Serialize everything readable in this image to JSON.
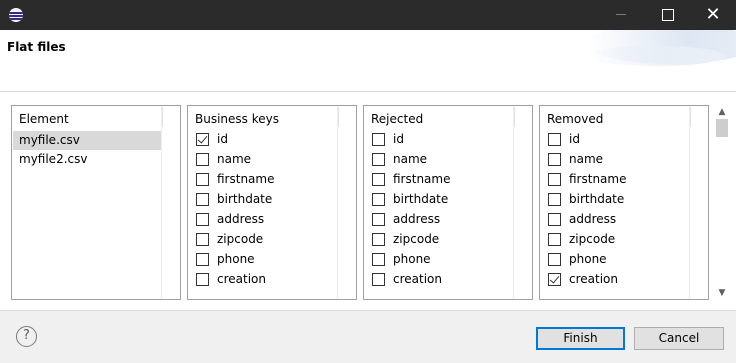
{
  "window": {
    "title": "",
    "close_glyph": "✕"
  },
  "header": {
    "title": "Flat files"
  },
  "element_panel": {
    "header": "Element",
    "items": [
      {
        "label": "myfile.csv",
        "selected": true
      },
      {
        "label": "myfile2.csv",
        "selected": false
      }
    ]
  },
  "business_keys": {
    "header": "Business keys",
    "items": [
      {
        "label": "id",
        "checked": true
      },
      {
        "label": "name",
        "checked": false
      },
      {
        "label": "firstname",
        "checked": false
      },
      {
        "label": "birthdate",
        "checked": false
      },
      {
        "label": "address",
        "checked": false
      },
      {
        "label": "zipcode",
        "checked": false
      },
      {
        "label": "phone",
        "checked": false
      },
      {
        "label": "creation",
        "checked": false
      }
    ]
  },
  "rejected": {
    "header": "Rejected",
    "items": [
      {
        "label": "id",
        "checked": false
      },
      {
        "label": "name",
        "checked": false
      },
      {
        "label": "firstname",
        "checked": false
      },
      {
        "label": "birthdate",
        "checked": false
      },
      {
        "label": "address",
        "checked": false
      },
      {
        "label": "zipcode",
        "checked": false
      },
      {
        "label": "phone",
        "checked": false
      },
      {
        "label": "creation",
        "checked": false
      }
    ]
  },
  "removed": {
    "header": "Removed",
    "items": [
      {
        "label": "id",
        "checked": false
      },
      {
        "label": "name",
        "checked": false
      },
      {
        "label": "firstname",
        "checked": false
      },
      {
        "label": "birthdate",
        "checked": false
      },
      {
        "label": "address",
        "checked": false
      },
      {
        "label": "zipcode",
        "checked": false
      },
      {
        "label": "phone",
        "checked": false
      },
      {
        "label": "creation",
        "checked": true
      }
    ]
  },
  "scrollbar": {
    "up_glyph": "▲",
    "down_glyph": "▼"
  },
  "footer": {
    "help_glyph": "?",
    "finish_label": "Finish",
    "cancel_label": "Cancel"
  },
  "icons": {
    "app": "eclipse-app-icon",
    "minimize": "minimize-icon",
    "maximize": "maximize-icon",
    "close": "close-icon",
    "help": "help-icon"
  },
  "colors": {
    "titlebar": "#2b2b2b",
    "default_button_border": "#0078d7",
    "selection": "#d9d9d9"
  }
}
